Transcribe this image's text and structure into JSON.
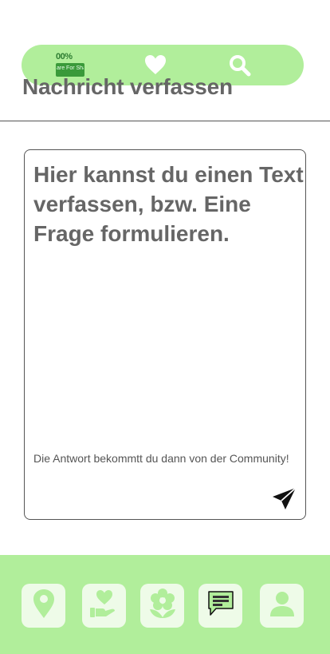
{
  "logo": {
    "top_text": "00%",
    "band_text": "are For Share"
  },
  "header": {
    "title": "Nachricht verfassen",
    "icons": [
      "heart-icon",
      "search-icon"
    ]
  },
  "compose": {
    "text": "Hier kannst du einen Text verfassen, bzw. Eine Frage formulieren.",
    "hint": "Die Antwort bekommtt du dann von der Community!",
    "send_icon": "send-icon"
  },
  "bottom_nav": {
    "items": [
      {
        "icon": "location-pin-icon"
      },
      {
        "icon": "hand-heart-icon"
      },
      {
        "icon": "flower-icon"
      },
      {
        "icon": "chat-icon",
        "active": true
      },
      {
        "icon": "user-icon"
      }
    ]
  },
  "colors": {
    "accent_green": "#b1ee9b",
    "nav_button_bg": "#eefbe8",
    "text_gray": "#666666",
    "icon_white": "#ffffff"
  }
}
